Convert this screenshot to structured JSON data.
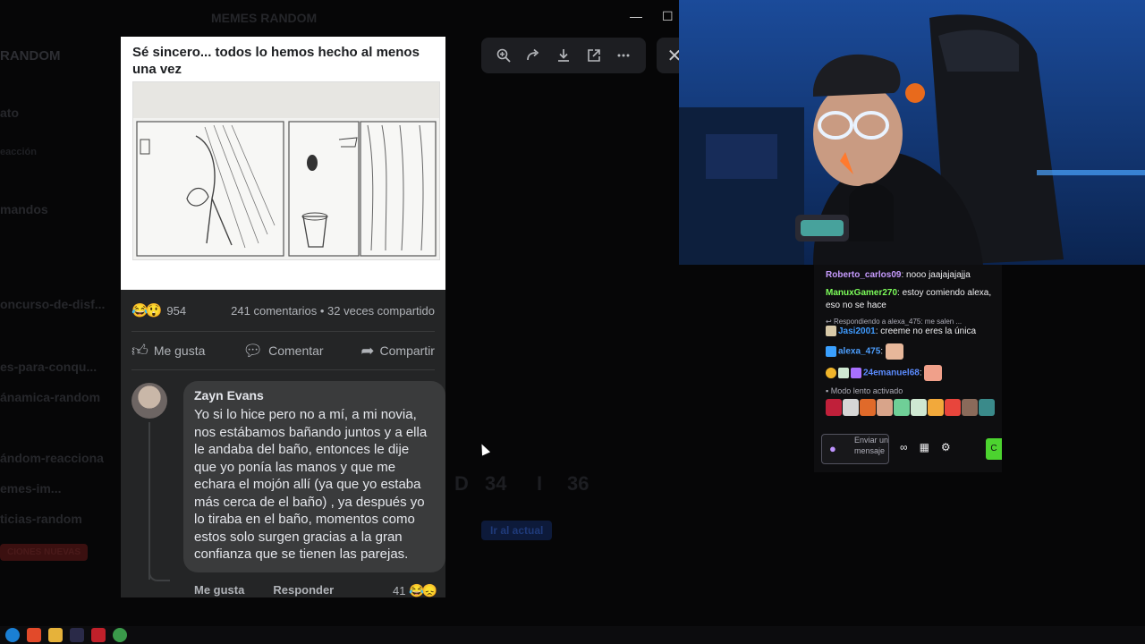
{
  "background": {
    "server_title": "MEMES RANDOM",
    "server_sidebar_name": "RANDOM",
    "channels": [
      "ato",
      "eacción",
      "mandos",
      "oncurso-de-disf...",
      "es-para-conqu...",
      "ánamica-random",
      "ándom-reacciona",
      "emes-im...",
      "ticias-random"
    ],
    "new_badge": "CIONES NUEVAS",
    "faint_letters": [
      "D",
      "34",
      "I",
      "36"
    ],
    "faint_button": "Ir al actual"
  },
  "viewer_toolbar": {
    "zoom_icon": "zoom-in-icon",
    "forward_icon": "forward-icon",
    "download_icon": "download-icon",
    "open_icon": "open-external-icon",
    "more_icon": "more-icon",
    "close_icon": "close-icon"
  },
  "post": {
    "title": "Sé sincero... todos lo hemos hecho al menos una vez",
    "reaction_count": "954",
    "stats": "241 comentarios • 32 veces compartido",
    "actions": {
      "like": "Me gusta",
      "comment": "Comentar",
      "share": "Compartir"
    },
    "comment": {
      "author": "Zayn Evans",
      "text": "Yo si lo hice pero no a mí, a mi novia, nos estábamos bañando juntos y a ella le andaba del baño, entonces le dije que yo ponía las manos y que me echara el mojón allí (ya que yo estaba más cerca de el baño) , ya después yo lo tiraba en el baño, momentos como estos solo surgen gracias a la gran confianza que se tienen las parejas.",
      "like_label": "Me gusta",
      "reply_label": "Responder",
      "reaction_count": "41"
    }
  },
  "chat": {
    "messages": [
      {
        "user": "Roberto_carlos09",
        "color": "#c79bff",
        "text": "nooo jaajajajajja"
      },
      {
        "user": "ManuxGamer270",
        "color": "#7cfc5a",
        "text": "estoy comiendo alexa, eso no se hace"
      },
      {
        "user": "Jasi2001",
        "color": "#3f9bff",
        "text": "creeme no eres la única"
      },
      {
        "user": "alexa_475",
        "color": "#4d9fff",
        "text": ""
      },
      {
        "user": "24emanuel68",
        "color": "#5b8cff",
        "text": ""
      }
    ],
    "reply_hint": "Respondiendo a alexa_475: me salen ...",
    "slow_mode": "Modo lento activado",
    "input_placeholder": "Enviar un mensaje",
    "send_label": "C"
  }
}
